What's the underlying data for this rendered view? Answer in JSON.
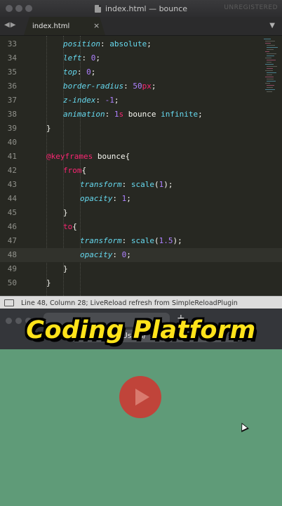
{
  "window": {
    "title": "index.html — bounce",
    "license_notice": "UNREGISTERED"
  },
  "tabs": [
    {
      "label": "index.html",
      "active": true
    }
  ],
  "editor": {
    "current_line": 48,
    "lines": [
      {
        "n": "33",
        "tokens": [
          [
            "prop",
            "position"
          ],
          [
            "punc",
            ": "
          ],
          [
            "val",
            "absolute"
          ],
          [
            "punc",
            ";"
          ]
        ],
        "indent": 2
      },
      {
        "n": "34",
        "tokens": [
          [
            "prop",
            "left"
          ],
          [
            "punc",
            ": "
          ],
          [
            "num",
            "0"
          ],
          [
            "punc",
            ";"
          ]
        ],
        "indent": 2
      },
      {
        "n": "35",
        "tokens": [
          [
            "prop",
            "top"
          ],
          [
            "punc",
            ": "
          ],
          [
            "num",
            "0"
          ],
          [
            "punc",
            ";"
          ]
        ],
        "indent": 2
      },
      {
        "n": "36",
        "tokens": [
          [
            "prop",
            "border-radius"
          ],
          [
            "punc",
            ": "
          ],
          [
            "num",
            "50"
          ],
          [
            "kw",
            "px"
          ],
          [
            "punc",
            ";"
          ]
        ],
        "indent": 2
      },
      {
        "n": "37",
        "tokens": [
          [
            "prop",
            "z-index"
          ],
          [
            "punc",
            ": "
          ],
          [
            "num",
            "-1"
          ],
          [
            "punc",
            ";"
          ]
        ],
        "indent": 2
      },
      {
        "n": "38",
        "tokens": [
          [
            "prop",
            "animation"
          ],
          [
            "punc",
            ": "
          ],
          [
            "num",
            "1"
          ],
          [
            "kw",
            "s"
          ],
          [
            "sel",
            " bounce "
          ],
          [
            "val",
            "infinite"
          ],
          [
            "punc",
            ";"
          ]
        ],
        "indent": 2
      },
      {
        "n": "39",
        "tokens": [
          [
            "punc",
            "}"
          ]
        ],
        "indent": 1
      },
      {
        "n": "40",
        "tokens": [],
        "indent": 0
      },
      {
        "n": "41",
        "tokens": [
          [
            "kw",
            "@keyframes"
          ],
          [
            "sel",
            " bounce{"
          ]
        ],
        "indent": 1
      },
      {
        "n": "42",
        "tokens": [
          [
            "kw",
            "from"
          ],
          [
            "punc",
            "{"
          ]
        ],
        "indent": 2
      },
      {
        "n": "43",
        "tokens": [
          [
            "prop",
            "transform"
          ],
          [
            "punc",
            ": "
          ],
          [
            "val",
            "scale"
          ],
          [
            "punc",
            "("
          ],
          [
            "num",
            "1"
          ],
          [
            "punc",
            ");"
          ]
        ],
        "indent": 3
      },
      {
        "n": "44",
        "tokens": [
          [
            "prop",
            "opacity"
          ],
          [
            "punc",
            ": "
          ],
          [
            "num",
            "1"
          ],
          [
            "punc",
            ";"
          ]
        ],
        "indent": 3
      },
      {
        "n": "45",
        "tokens": [
          [
            "punc",
            "}"
          ]
        ],
        "indent": 2
      },
      {
        "n": "46",
        "tokens": [
          [
            "kw",
            "to"
          ],
          [
            "punc",
            "{"
          ]
        ],
        "indent": 2
      },
      {
        "n": "47",
        "tokens": [
          [
            "prop",
            "transform"
          ],
          [
            "punc",
            ": "
          ],
          [
            "val",
            "scale"
          ],
          [
            "punc",
            "("
          ],
          [
            "num",
            "1.5"
          ],
          [
            "punc",
            ");"
          ]
        ],
        "indent": 3
      },
      {
        "n": "48",
        "tokens": [
          [
            "prop",
            "opacity"
          ],
          [
            "punc",
            ": "
          ],
          [
            "num",
            "0"
          ],
          [
            "punc",
            ";"
          ]
        ],
        "indent": 3
      },
      {
        "n": "49",
        "tokens": [
          [
            "punc",
            "}"
          ]
        ],
        "indent": 2
      },
      {
        "n": "50",
        "tokens": [
          [
            "punc",
            "}"
          ]
        ],
        "indent": 1
      }
    ]
  },
  "status_bar": {
    "text": "Line 48, Column 28; LiveReload refresh from SimpleReloadPlugin"
  },
  "browser": {
    "url_text": "/Users/"
  },
  "overlay": {
    "banner_text": "Coding Platform"
  },
  "colors": {
    "editor_bg": "#272822",
    "preview_bg": "#5f9b78",
    "play_button": "#c0443a",
    "banner_text": "#ffe31a"
  }
}
